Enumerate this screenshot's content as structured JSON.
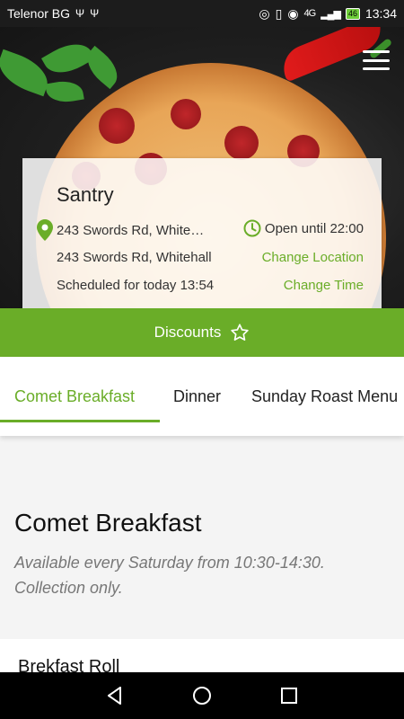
{
  "status_bar": {
    "carrier": "Telenor BG",
    "network": "4G",
    "battery": "46",
    "time": "13:34"
  },
  "store": {
    "name": "Santry",
    "address_short": "243 Swords Rd, White…",
    "address_full": "243 Swords Rd, Whitehall",
    "open_status": "Open until 22:00",
    "change_location": "Change Location",
    "scheduled": "Scheduled for today 13:54",
    "change_time": "Change Time"
  },
  "discounts": {
    "label": "Discounts"
  },
  "tabs": [
    {
      "label": "Comet Breakfast",
      "active": true
    },
    {
      "label": "Dinner",
      "active": false
    },
    {
      "label": "Sunday Roast Menu",
      "active": false
    }
  ],
  "section": {
    "title": "Comet Breakfast",
    "description": "Available every Saturday from 10:30-14:30. Collection only."
  },
  "items": [
    {
      "name": "Brekfast Roll"
    }
  ],
  "colors": {
    "accent": "#6aad28",
    "status_bar": "#1c1c1c",
    "nav_bar": "#000000"
  }
}
